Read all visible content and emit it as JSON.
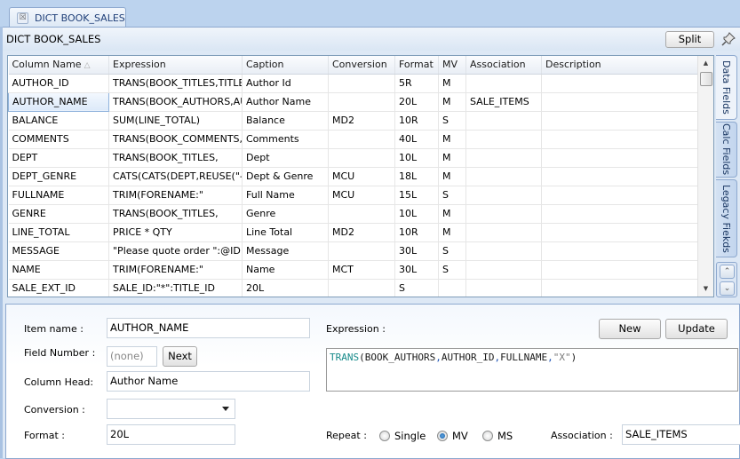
{
  "tab": {
    "label": "DICT BOOK_SALES",
    "close_icon": "close-icon"
  },
  "header": {
    "title": "DICT BOOK_SALES",
    "split_label": "Split",
    "pin_icon": "pushpin-icon"
  },
  "grid": {
    "columns": [
      "Column Name",
      "Expression",
      "Caption",
      "Conversion",
      "Format",
      "MV",
      "Association",
      "Description"
    ],
    "sort_indicator": "△",
    "selected_row": 1,
    "rows": [
      [
        "AUTHOR_ID",
        "TRANS(BOOK_TITLES,TITLE_",
        "Author Id",
        "",
        "5R",
        "M",
        "",
        ""
      ],
      [
        "AUTHOR_NAME",
        "TRANS(BOOK_AUTHORS,AUT",
        "Author Name",
        "",
        "20L",
        "M",
        "SALE_ITEMS",
        ""
      ],
      [
        "BALANCE",
        "SUM(LINE_TOTAL)",
        "Balance",
        "MD2",
        "10R",
        "S",
        "",
        ""
      ],
      [
        "COMMENTS",
        "TRANS(BOOK_COMMENTS,TI",
        "Comments",
        "",
        "40L",
        "M",
        "",
        ""
      ],
      [
        "DEPT",
        "TRANS(BOOK_TITLES,",
        "Dept",
        "",
        "10L",
        "M",
        "",
        ""
      ],
      [
        "DEPT_GENRE",
        "CATS(CATS(DEPT,REUSE(\"-\")",
        "Dept & Genre",
        "MCU",
        "18L",
        "M",
        "",
        ""
      ],
      [
        "FULLNAME",
        "TRIM(FORENAME:\"",
        "Full Name",
        "MCU",
        "15L",
        "S",
        "",
        ""
      ],
      [
        "GENRE",
        "TRANS(BOOK_TITLES,",
        "Genre",
        "",
        "10L",
        "M",
        "",
        ""
      ],
      [
        "LINE_TOTAL",
        "PRICE * QTY",
        "Line Total",
        "MD2",
        "10R",
        "M",
        "",
        ""
      ],
      [
        "MESSAGE",
        "\"Please quote order \":@ID:\"",
        "Message",
        "",
        "30L",
        "S",
        "",
        ""
      ],
      [
        "NAME",
        "TRIM(FORENAME:\"",
        "Name",
        "MCT",
        "30L",
        "S",
        "",
        ""
      ],
      [
        "SALE_EXT_ID",
        "SALE_ID:\"*\":TITLE_ID",
        "20L",
        "",
        "S",
        "",
        "",
        ""
      ]
    ]
  },
  "side_tabs": [
    {
      "label": "Data Fields",
      "active": true
    },
    {
      "label": "Calc Fields",
      "active": false
    },
    {
      "label": "Legacy Fiekds",
      "active": false
    }
  ],
  "side_nav": {
    "up_icon": "chevron-up-icon",
    "down_icon": "chevron-down-icon"
  },
  "editor": {
    "item_name_label": "Item name :",
    "item_name_value": "AUTHOR_NAME",
    "field_number_label": "Field Number :",
    "field_number_placeholder": "(none)",
    "next_label": "Next",
    "column_head_label": "Column Head:",
    "column_head_value": "Author Name",
    "conversion_label": "Conversion :",
    "conversion_value": "",
    "format_label": "Format :",
    "format_value": "20L",
    "expression_label": "Expression :",
    "new_label": "New",
    "update_label": "Update",
    "expression": {
      "fn": "TRANS",
      "open": "(",
      "arg1": "BOOK_AUTHORS",
      "arg2": "AUTHOR_ID",
      "arg3": "FULLNAME",
      "arg4": "\"X\"",
      "comma": ",",
      "close": ")"
    },
    "repeat_label": "Repeat :",
    "repeat_options": [
      "Single",
      "MV",
      "MS"
    ],
    "repeat_selected": "MV",
    "association_label": "Association :",
    "association_value": "SALE_ITEMS"
  },
  "colors": {
    "accent": "#bcd3ee",
    "border": "#8ea9cf",
    "keyword": "#178a8a",
    "comma": "#1a4fb3"
  }
}
